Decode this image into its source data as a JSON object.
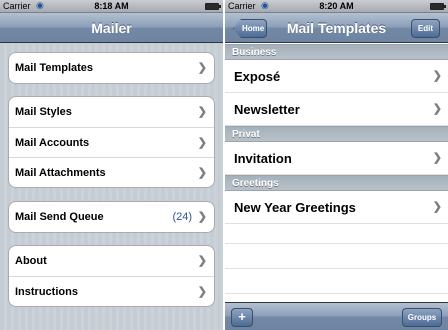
{
  "left_screen": {
    "status": {
      "carrier": "Carrier",
      "time": "8:18 AM"
    },
    "title": "Mailer",
    "groups": [
      {
        "rows": [
          {
            "label": "Mail Templates"
          }
        ]
      },
      {
        "rows": [
          {
            "label": "Mail Styles"
          },
          {
            "label": "Mail Accounts"
          },
          {
            "label": "Mail Attachments"
          }
        ]
      },
      {
        "rows": [
          {
            "label": "Mail Send Queue",
            "count": "(24)"
          }
        ]
      },
      {
        "rows": [
          {
            "label": "About"
          },
          {
            "label": "Instructions"
          }
        ]
      }
    ]
  },
  "right_screen": {
    "status": {
      "carrier": "Carrier",
      "time": "8:20 AM"
    },
    "title": "Mail Templates",
    "back_label": "Home",
    "edit_label": "Edit",
    "sections": [
      {
        "header": "Business",
        "rows": [
          "Exposé",
          "Newsletter"
        ]
      },
      {
        "header": "Privat",
        "rows": [
          "Invitation"
        ]
      },
      {
        "header": "Greetings",
        "rows": [
          "New Year Greetings"
        ]
      }
    ],
    "toolbar": {
      "add_label": "+",
      "groups_label": "Groups"
    }
  },
  "colors": {
    "nav_blue": "#6d84a2",
    "section_gray": "#a5b1ba",
    "count_blue": "#385487"
  },
  "icons": [
    "wifi-icon",
    "battery-icon",
    "chevron-right-icon",
    "plus-icon"
  ]
}
